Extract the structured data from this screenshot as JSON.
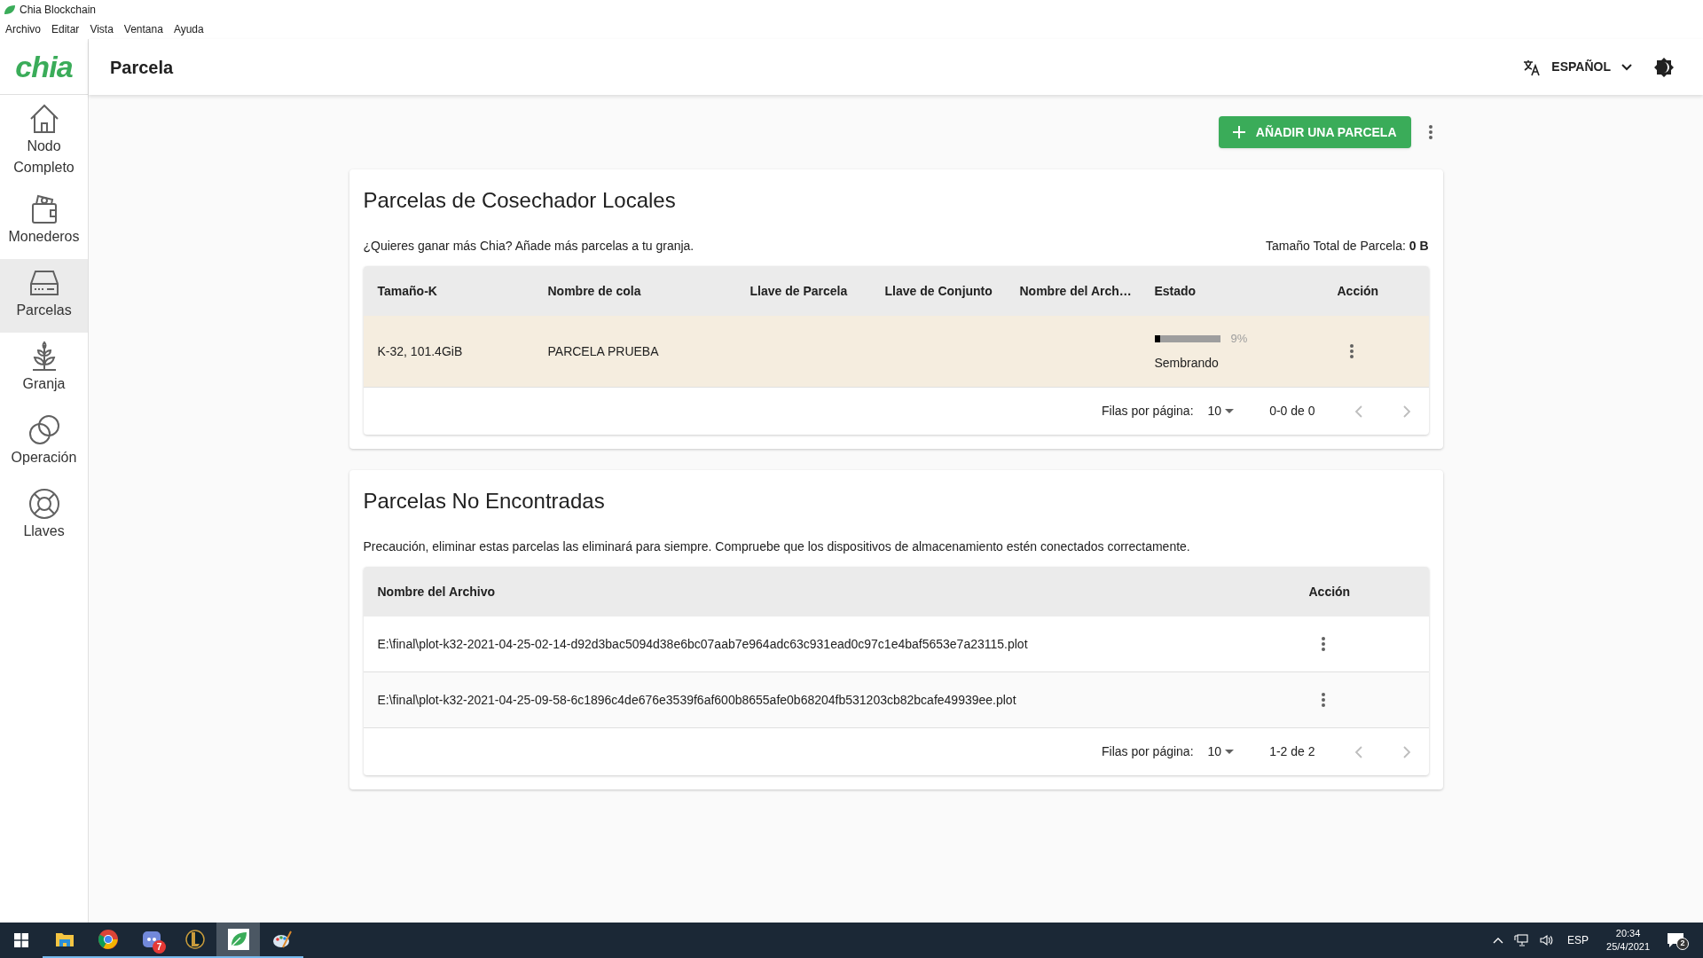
{
  "window": {
    "title": "Chia Blockchain"
  },
  "menu": [
    "Archivo",
    "Editar",
    "Vista",
    "Ventana",
    "Ayuda"
  ],
  "header": {
    "logo": "chia",
    "title": "Parcela",
    "language": "ESPAÑOL"
  },
  "sidebar": {
    "items": [
      {
        "kind": "home",
        "label": "Nodo Completo",
        "selected": false
      },
      {
        "kind": "wallet",
        "label": "Monederos",
        "selected": false
      },
      {
        "kind": "drive",
        "label": "Parcelas",
        "selected": true
      },
      {
        "kind": "plant",
        "label": "Granja",
        "selected": false
      },
      {
        "kind": "circles",
        "label": "Operación",
        "selected": false
      },
      {
        "kind": "lifebuoy",
        "label": "Llaves",
        "selected": false
      }
    ]
  },
  "add_button": "AÑADIR UNA PARCELA",
  "local_plots": {
    "title": "Parcelas de Cosechador Locales",
    "note": "¿Quieres ganar más Chia? Añade más parcelas a tu granja.",
    "total_label": "Tamaño Total de Parcela:",
    "total_value": "0 B",
    "columns": [
      "Tamaño-K",
      "Nombre de cola",
      "Llave de Parcela",
      "Llave de Conjunto",
      "Nombre del Arch…",
      "Estado",
      "Acción"
    ],
    "rows": [
      {
        "size": "K-32, 101.4GiB",
        "queue": "PARCELA PRUEBA",
        "level": 0.09,
        "percent": "9%",
        "status": "Sembrando"
      }
    ],
    "pagination": {
      "rows_label": "Filas por página:",
      "rows_value": "10",
      "range": "0-0 de 0"
    }
  },
  "not_found": {
    "title": "Parcelas No Encontradas",
    "note": "Precaución, eliminar estas parcelas las eliminará para siempre. Compruebe que los dispositivos de almacenamiento estén conectados correctamente.",
    "columns": [
      "Nombre del Archivo",
      "Acción"
    ],
    "rows": [
      {
        "file": "E:\\final\\plot-k32-2021-04-25-02-14-d92d3bac5094d38e6bc07aab7e964adc63c931ead0c97c1e4baf5653e7a23115.plot"
      },
      {
        "file": "E:\\final\\plot-k32-2021-04-25-09-58-6c1896c4de676e3539f6af600b8655afe0b68204fb531203cb82bcafe49939ee.plot"
      }
    ],
    "pagination": {
      "rows_label": "Filas por página:",
      "rows_value": "10",
      "range": "1-2 de 2"
    }
  },
  "taskbar": {
    "apps": [
      {
        "kind": "folder",
        "selected": false
      },
      {
        "kind": "chrome",
        "selected": false
      },
      {
        "kind": "chat",
        "selected": false,
        "badge": "7"
      },
      {
        "kind": "league",
        "selected": false
      },
      {
        "kind": "leaf",
        "selected": true
      },
      {
        "kind": "paint",
        "selected": false
      }
    ],
    "tray": {
      "language": "ESP",
      "time": "20:34",
      "date": "25/4/2021",
      "notifications": "2"
    }
  }
}
